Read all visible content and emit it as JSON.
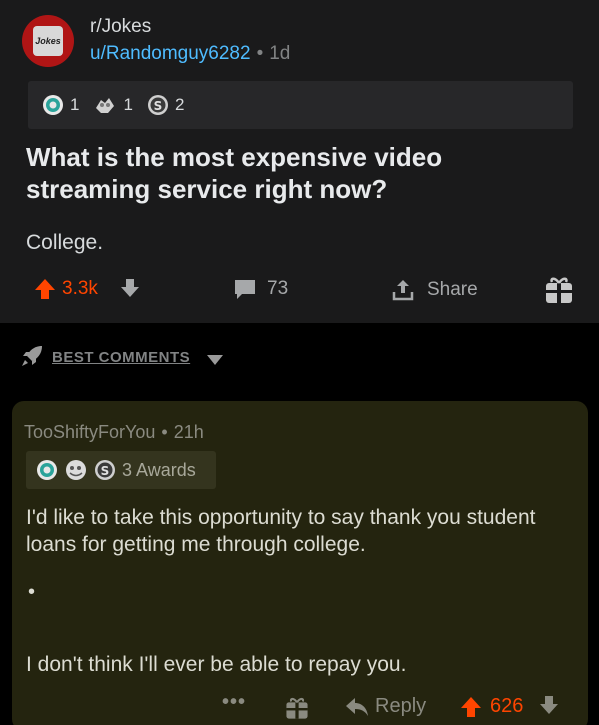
{
  "post": {
    "subreddit": "r/Jokes",
    "author": "u/Randomguy6282",
    "separator": "•",
    "age": "1d",
    "awards": [
      {
        "icon": "helpful-award-icon",
        "count": "1"
      },
      {
        "icon": "wholesome-award-icon",
        "count": "1"
      },
      {
        "icon": "silver-award-icon",
        "count": "2"
      }
    ],
    "title": "What is the most expensive video streaming service right now?",
    "body": "College.",
    "votes": "3.3k",
    "comments": "73",
    "share_label": "Share"
  },
  "sort": {
    "label": "BEST COMMENTS"
  },
  "comment": {
    "author": "TooShiftyForYou",
    "separator": "•",
    "age": "21h",
    "awards_label": "3 Awards",
    "text": "I'd like to take this opportunity to say thank you student loans for getting me through college.",
    "bullet": "•",
    "text2": "I don't think I'll ever be able to repay you.",
    "more": "•••",
    "reply_label": "Reply",
    "votes": "626"
  },
  "colors": {
    "upvote": "#ff4500",
    "link": "#4fbcff",
    "background": "#1a1a1b",
    "comment_bg": "#24240f"
  }
}
